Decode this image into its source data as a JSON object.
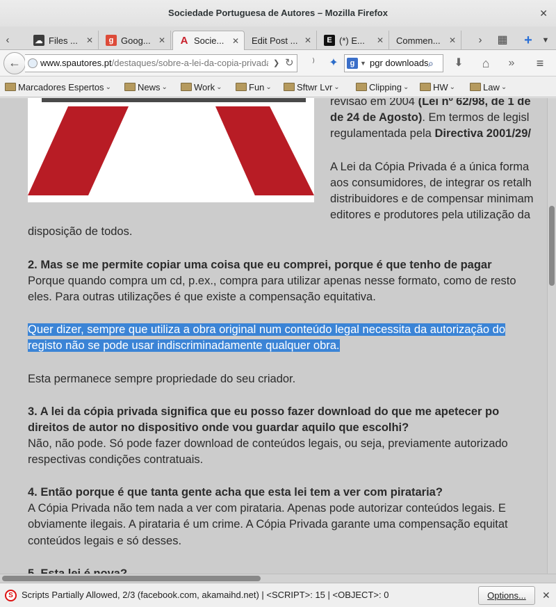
{
  "window": {
    "title": "Sociedade Portuguesa de Autores – Mozilla Firefox"
  },
  "tabs": [
    {
      "label": "Files ..."
    },
    {
      "label": "Goog..."
    },
    {
      "label": "Socie..."
    },
    {
      "label": "Edit Post ..."
    },
    {
      "label": "(*) E..."
    },
    {
      "label": "Commen..."
    }
  ],
  "nav": {
    "url_domain": "www.spautores.pt",
    "url_path": "/destaques/sobre-a-lei-da-copia-privada",
    "search_text": "pgr downloads"
  },
  "bookmarks": [
    "Marcadores Espertos",
    "News",
    "Work",
    "Fun",
    "Sftwr Lvr",
    "Clipping",
    "HW",
    "Law"
  ],
  "content": {
    "r0a": "revisão em 2004 ",
    "r0b": "(Lei nº 62/98, de 1 de",
    "r1a": "de 24 de Agosto)",
    "r1b": ". Em termos de legisl",
    "r2a": "regulamentada pela ",
    "r2b": "Directiva 2001/29/",
    "r3": "A Lei da Cópia Privada é a única forma",
    "r4": "aos consumidores, de integrar os retalh",
    "r5": "distribuidores e de compensar minimam",
    "r6": "editores e produtores pela utilização da",
    "l1": "disposição de todos.",
    "q2": "2. Mas se me permite copiar uma coisa que eu comprei, porque é que tenho de pagar",
    "a2a": "Porque quando compra um cd, p.ex., compra para utilizar apenas nesse formato, como de resto",
    "a2b": "eles. Para outras utilizações é que existe a compensação equitativa.",
    "hl1": "Quer dizer, sempre que utiliza a obra original num conteúdo legal necessita da autorização do",
    "hl2": "registo não se pode usar indiscriminadamente qualquer obra.",
    "pm": "Esta permanece sempre propriedade do seu criador.",
    "q3a": "3. A lei da cópia privada significa que eu posso fazer download do que me apetecer po",
    "q3b": "direitos de autor no dispositivo onde vou guardar aquilo que escolhi?",
    "a3a": "Não, não pode. Só pode fazer download de conteúdos legais, ou seja, previamente autorizado",
    "a3b": "respectivas condições contratuais.",
    "q4": "4. Então porque é que tanta gente acha que esta lei tem a ver com pirataria?",
    "a4a": "A Cópia Privada não tem nada a ver com pirataria. Apenas pode autorizar conteúdos legais. E",
    "a4b": "obviamente ilegais. A pirataria é um crime. A Cópia Privada garante uma compensação equitat",
    "a4c": "conteúdos legais e só desses.",
    "q5": "5. Esta lei é nova?"
  },
  "status": {
    "text": "Scripts Partially Allowed, 2/3 (facebook.com, akamaihd.net) | <SCRIPT>: 15 | <OBJECT>: 0",
    "options_label": "Options..."
  }
}
